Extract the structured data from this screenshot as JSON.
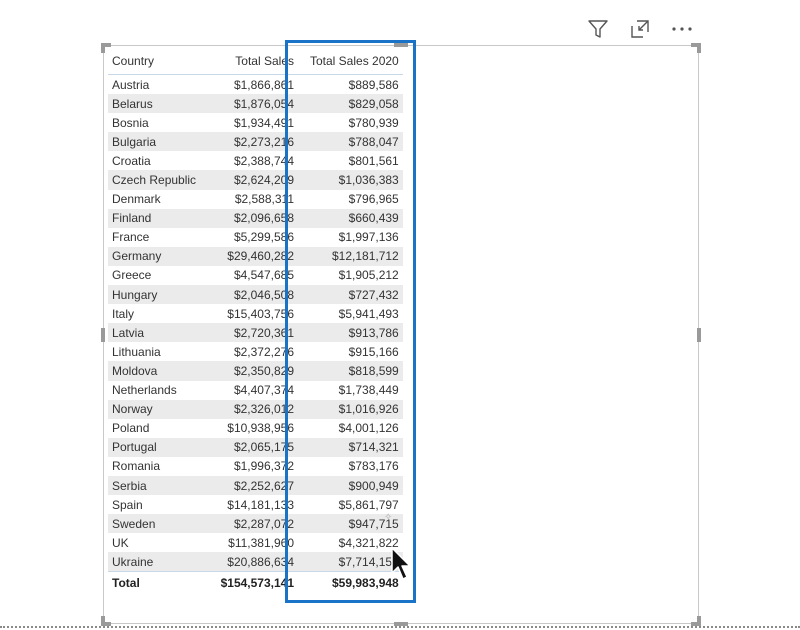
{
  "table": {
    "headers": {
      "country": "Country",
      "total_sales": "Total Sales",
      "total_sales_2020": "Total Sales 2020"
    },
    "rows": [
      {
        "country": "Austria",
        "total_sales": "$1,866,861",
        "total_sales_2020": "$889,586"
      },
      {
        "country": "Belarus",
        "total_sales": "$1,876,054",
        "total_sales_2020": "$829,058"
      },
      {
        "country": "Bosnia",
        "total_sales": "$1,934,491",
        "total_sales_2020": "$780,939"
      },
      {
        "country": "Bulgaria",
        "total_sales": "$2,273,216",
        "total_sales_2020": "$788,047"
      },
      {
        "country": "Croatia",
        "total_sales": "$2,388,744",
        "total_sales_2020": "$801,561"
      },
      {
        "country": "Czech Republic",
        "total_sales": "$2,624,209",
        "total_sales_2020": "$1,036,383"
      },
      {
        "country": "Denmark",
        "total_sales": "$2,588,311",
        "total_sales_2020": "$796,965"
      },
      {
        "country": "Finland",
        "total_sales": "$2,096,658",
        "total_sales_2020": "$660,439"
      },
      {
        "country": "France",
        "total_sales": "$5,299,586",
        "total_sales_2020": "$1,997,136"
      },
      {
        "country": "Germany",
        "total_sales": "$29,460,282",
        "total_sales_2020": "$12,181,712"
      },
      {
        "country": "Greece",
        "total_sales": "$4,547,685",
        "total_sales_2020": "$1,905,212"
      },
      {
        "country": "Hungary",
        "total_sales": "$2,046,508",
        "total_sales_2020": "$727,432"
      },
      {
        "country": "Italy",
        "total_sales": "$15,403,756",
        "total_sales_2020": "$5,941,493"
      },
      {
        "country": "Latvia",
        "total_sales": "$2,720,361",
        "total_sales_2020": "$913,786"
      },
      {
        "country": "Lithuania",
        "total_sales": "$2,372,276",
        "total_sales_2020": "$915,166"
      },
      {
        "country": "Moldova",
        "total_sales": "$2,350,829",
        "total_sales_2020": "$818,599"
      },
      {
        "country": "Netherlands",
        "total_sales": "$4,407,374",
        "total_sales_2020": "$1,738,449"
      },
      {
        "country": "Norway",
        "total_sales": "$2,326,012",
        "total_sales_2020": "$1,016,926"
      },
      {
        "country": "Poland",
        "total_sales": "$10,938,956",
        "total_sales_2020": "$4,001,126"
      },
      {
        "country": "Portugal",
        "total_sales": "$2,065,175",
        "total_sales_2020": "$714,321"
      },
      {
        "country": "Romania",
        "total_sales": "$1,996,372",
        "total_sales_2020": "$783,176"
      },
      {
        "country": "Serbia",
        "total_sales": "$2,252,627",
        "total_sales_2020": "$900,949"
      },
      {
        "country": "Spain",
        "total_sales": "$14,181,133",
        "total_sales_2020": "$5,861,797"
      },
      {
        "country": "Sweden",
        "total_sales": "$2,287,072",
        "total_sales_2020": "$947,715"
      },
      {
        "country": "UK",
        "total_sales": "$11,381,960",
        "total_sales_2020": "$4,321,822"
      },
      {
        "country": "Ukraine",
        "total_sales": "$20,886,634",
        "total_sales_2020": "$7,714,152"
      }
    ],
    "total": {
      "label": "Total",
      "total_sales": "$154,573,141",
      "total_sales_2020": "$59,983,948"
    }
  },
  "toolbar": {
    "icons": [
      "filter-icon",
      "focus-mode-icon",
      "more-options-icon"
    ]
  },
  "colors": {
    "highlight": "#1a73c7",
    "alt_row": "#ebebeb",
    "frame": "#c8c8c8"
  }
}
